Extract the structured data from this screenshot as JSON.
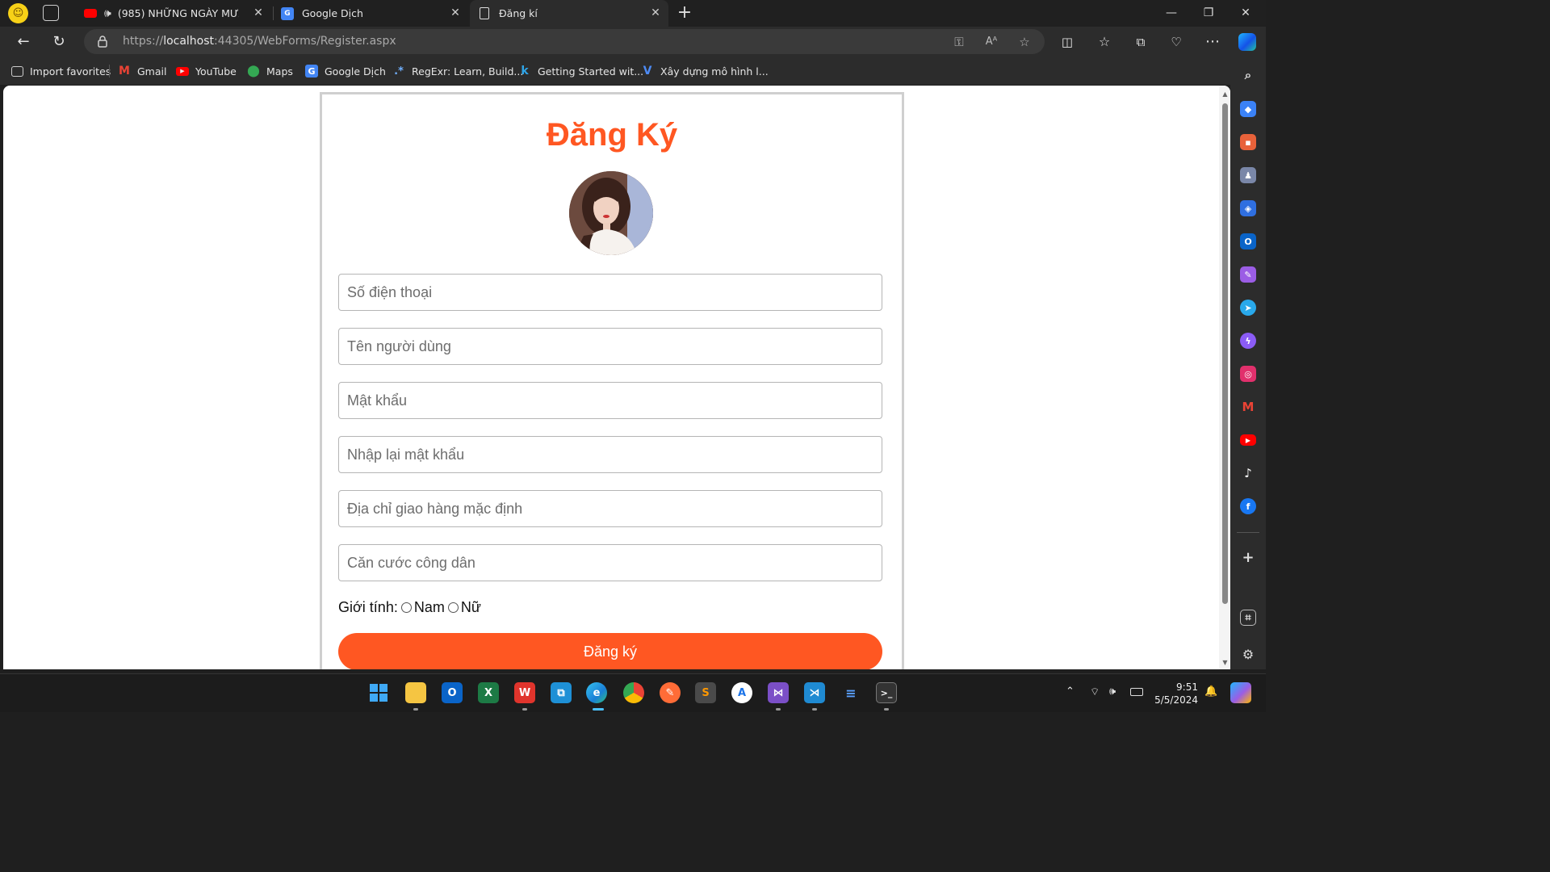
{
  "browser": {
    "tabs": [
      {
        "title": "(985) NHỮNG NGÀY MƯA -",
        "icon": "youtube-icon",
        "audio": true
      },
      {
        "title": "Google Dịch",
        "icon": "google-translate-icon"
      },
      {
        "title": "Đăng kí",
        "icon": "page-icon",
        "active": true
      }
    ],
    "new_tab": "+",
    "url_prefix": "https://",
    "url_host": "localhost",
    "url_rest": ":44305/WebForms/Register.aspx",
    "favorites": [
      {
        "label": "Import favorites",
        "icon": "import-icon"
      },
      {
        "label": "Gmail",
        "icon": "gmail-icon"
      },
      {
        "label": "YouTube",
        "icon": "youtube-icon"
      },
      {
        "label": "Maps",
        "icon": "maps-icon"
      },
      {
        "label": "Google Dịch",
        "icon": "google-translate-icon"
      },
      {
        "label": "RegExr: Learn, Build...",
        "icon": "regexr-icon"
      },
      {
        "label": "Getting Started wit...",
        "icon": "k-icon"
      },
      {
        "label": "Xây dựng mô hình l...",
        "icon": "v-icon"
      }
    ]
  },
  "page": {
    "title": "Đăng Ký",
    "fields": [
      {
        "placeholder": "Số điện thoại"
      },
      {
        "placeholder": "Tên người dùng"
      },
      {
        "placeholder": "Mật khẩu"
      },
      {
        "placeholder": "Nhập lại mật khẩu"
      },
      {
        "placeholder": "Địa chỉ giao hàng mặc định"
      },
      {
        "placeholder": "Căn cước công dân"
      }
    ],
    "gender_label": "Giới tính:",
    "gender_options": [
      "Nam",
      "Nữ"
    ],
    "submit_label": "Đăng ký",
    "accent_color": "#ff5722"
  },
  "taskbar": {
    "time": "9:51",
    "date": "5/5/2024"
  }
}
